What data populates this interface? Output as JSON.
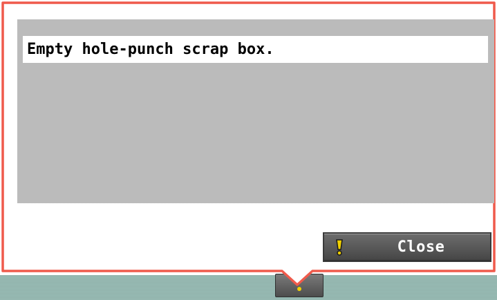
{
  "dialog": {
    "message": "Empty hole-punch scrap box.",
    "close_label": "Close"
  },
  "colors": {
    "frame_border": "#ef5a4b",
    "message_panel_bg": "#bfbfbf",
    "bottom_strip_bg": "#8fb3ac",
    "button_bg": "#5a5a5a",
    "warning_icon": "#f0d000"
  },
  "icons": {
    "close_icon": "exclamation-warning-icon",
    "bottom_tab_icon": "status-indicator-icon"
  }
}
